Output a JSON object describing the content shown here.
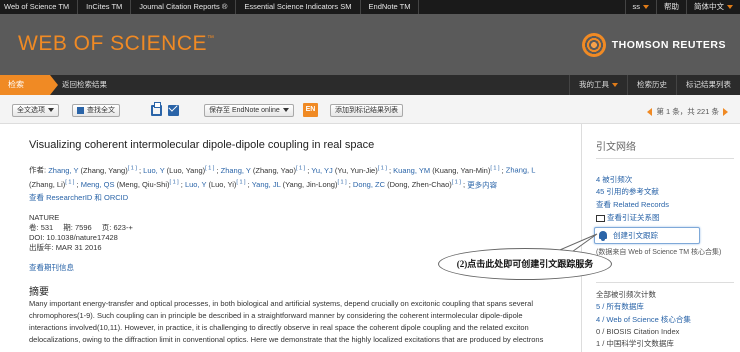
{
  "topbar": {
    "left_links": [
      "Web of Science TM",
      "InCites TM",
      "Journal Citation Reports ®",
      "Essential Science Indicators SM",
      "EndNote TM"
    ],
    "user": "ss",
    "help": "帮助",
    "language": "简体中文"
  },
  "header": {
    "logo": "WEB OF SCIENCE",
    "logo_tm": "™",
    "brand": "THOMSON REUTERS"
  },
  "nav": {
    "search_tab": "检索",
    "back_link": "返回检索结果",
    "my_tools": "我的工具",
    "search_history": "检索历史",
    "marked_list": "标记结果列表"
  },
  "toolbar": {
    "fulltext_options": "全文选项",
    "find_fulltext": "查找全文",
    "save_select": "保存至 EndNote online",
    "en_label": "EN",
    "add_to_marked": "添加到标记结果列表",
    "pager": "第 1 条，共 221 条"
  },
  "record": {
    "title": "Visualizing coherent intermolecular dipole-dipole coupling in real space",
    "authors_prefix": "作者:",
    "authors_line1": [
      {
        "name": "Zhang, Y",
        "full": "(Zhang, Yang)",
        "sup": "[ 1 ]"
      },
      {
        "name": "Luo, Y",
        "full": "(Luo, Yang)",
        "sup": "[ 1 ]"
      },
      {
        "name": "Zhang, Y",
        "full": "(Zhang, Yao)",
        "sup": "[ 1 ]"
      },
      {
        "name": "Yu, YJ",
        "full": "(Yu, Yun-Jie)",
        "sup": "[ 1 ]"
      },
      {
        "name": "Kuang, YM",
        "full": "(Kuang, Yan-Min)",
        "sup": "[ 1 ]"
      },
      {
        "name": "Zhang, L",
        "full": "",
        "sup": ""
      }
    ],
    "authors_line2": [
      {
        "name": "",
        "full": "(Zhang, Li)",
        "sup": "[ 1 ]"
      },
      {
        "name": "Meng, QS",
        "full": "(Meng, Qiu-Shi)",
        "sup": "[ 1 ]"
      },
      {
        "name": "Luo, Y",
        "full": "(Luo, Yi)",
        "sup": "[ 1 ]"
      },
      {
        "name": "Yang, JL",
        "full": "(Yang, Jin-Long)",
        "sup": "[ 1 ]"
      },
      {
        "name": "Dong, ZC",
        "full": "(Dong, Zhen-Chao)",
        "sup": "[ 1 ]"
      }
    ],
    "more": "更多内容",
    "researcher_id": "查看 ResearcherID 和 ORCID",
    "journal_name": "NATURE",
    "volume_label": "卷:",
    "volume": "531",
    "issue_label": "期:",
    "issue": "7596",
    "pages_label": "页:",
    "pages": "623-+",
    "doi_label": "DOI:",
    "doi": "10.1038/nature17428",
    "pubdate_label": "出版年:",
    "pubdate": "MAR 31 2016",
    "journal_info": "查看期刊信息",
    "abstract_heading": "摘要",
    "abstract_lines": [
      "Many important energy-transfer and optical processes, in both biological and artificial systems, depend crucially on excitonic coupling that spans several",
      "chromophores(1-9). Such coupling can in principle be described in a straightforward manner by considering the coherent intermolecular dipole-dipole",
      "interactions involved(10,11). However, in practice, it is challenging to directly observe in real space the coherent dipole coupling and the related exciton",
      "delocalizations, owing to the diffraction limit in conventional optics. Here we demonstrate that the highly localized excitations that are produced by electrons"
    ]
  },
  "sidebar": {
    "heading": "引文网络",
    "cited_times": "4 被引频次",
    "references": "45 引用的参考文献",
    "related": "查看 Related Records",
    "citation_map": "查看引证关系图",
    "create_alert": "创建引文跟踪",
    "core_note": "(数据来自 Web of Science TM 核心合集)",
    "all_db_heading": "全部被引频次计数",
    "all_db_count": "5 / 所有数据库",
    "wos_core": "4 / Web of Science 核心合集",
    "biosis": "0 / BIOSIS Citation Index",
    "cscd": "1 / 中国科学引文数据库"
  },
  "callout": {
    "text": "(2)点击此处即可创建引文跟踪服务"
  }
}
